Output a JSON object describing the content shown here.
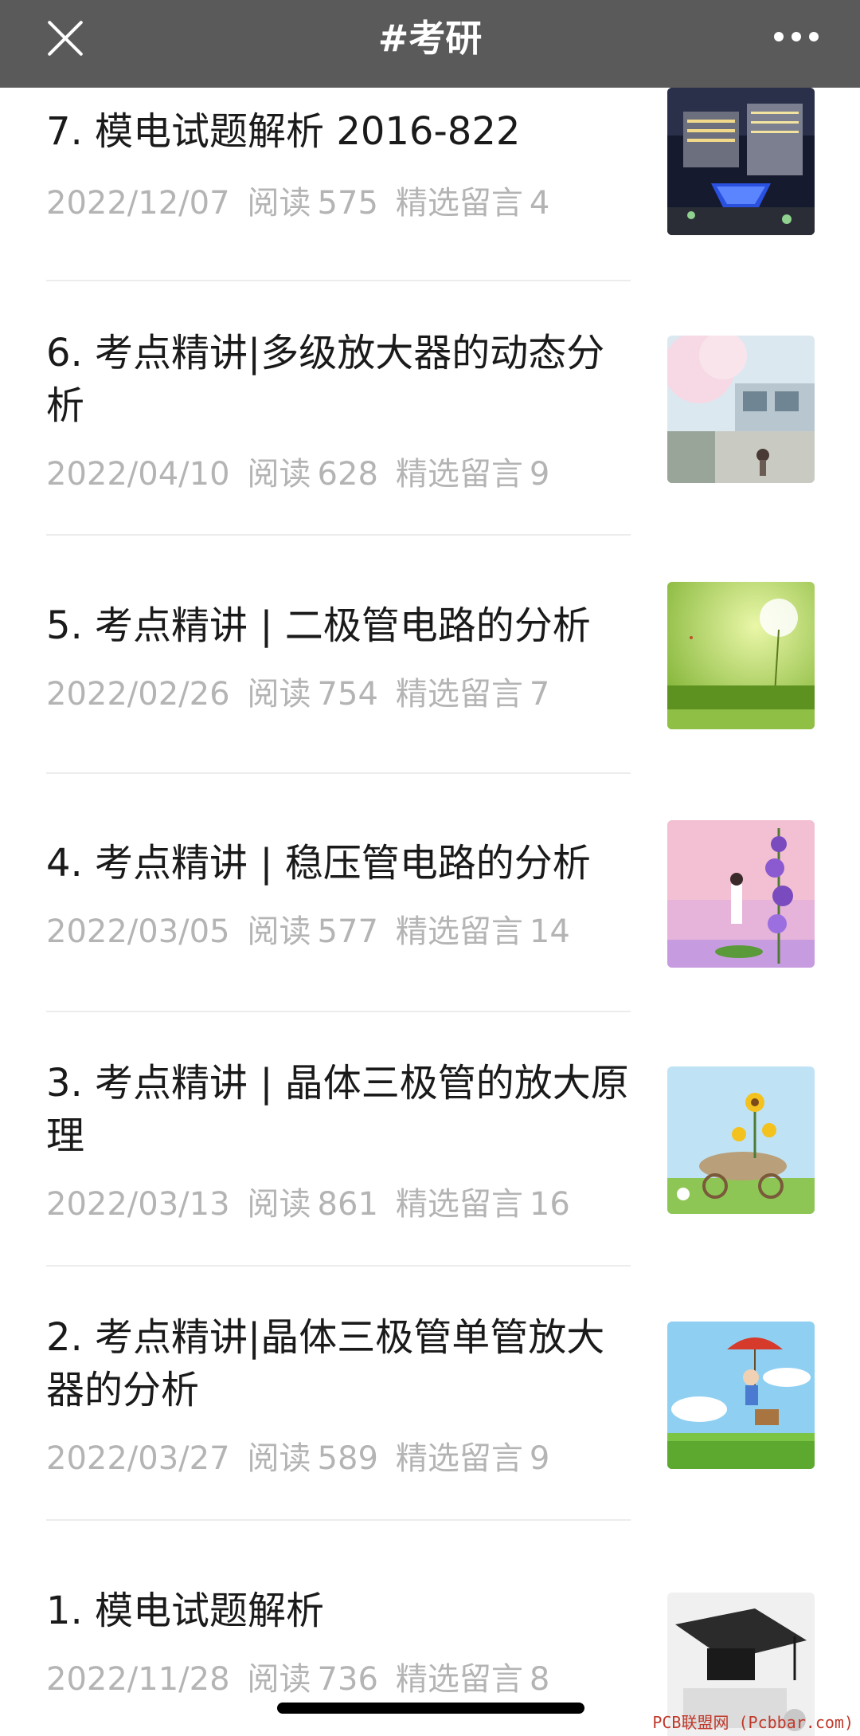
{
  "header": {
    "title": "#考研"
  },
  "icons": {
    "close": "close-icon",
    "more": "more-icon"
  },
  "meta_labels": {
    "read": "阅读",
    "comments": "精选留言"
  },
  "items": [
    {
      "title": "7. 模电试题解析 2016-822",
      "date": "2022/12/07",
      "reads": "575",
      "comments": "4",
      "thumb": "campus-night-scene"
    },
    {
      "title": "6. 考点精讲|多级放大器的动态分析",
      "date": "2022/04/10",
      "reads": "628",
      "comments": "9",
      "thumb": "cherry-blossom-street"
    },
    {
      "title": "5. 考点精讲 | 二极管电路的分析",
      "date": "2022/02/26",
      "reads": "754",
      "comments": "7",
      "thumb": "green-dandelion-field"
    },
    {
      "title": "4. 考点精讲 | 稳压管电路的分析",
      "date": "2022/03/05",
      "reads": "577",
      "comments": "14",
      "thumb": "pink-girl-lavender"
    },
    {
      "title": "3. 考点精讲 | 晶体三极管的放大原理",
      "date": "2022/03/13",
      "reads": "861",
      "comments": "16",
      "thumb": "sunflower-cart"
    },
    {
      "title": "2. 考点精讲|晶体三极管单管放大器的分析",
      "date": "2022/03/27",
      "reads": "589",
      "comments": "9",
      "thumb": "girl-with-umbrella"
    },
    {
      "title": "1. 模电试题解析",
      "date": "2022/11/28",
      "reads": "736",
      "comments": "8",
      "thumb": "graduation-cap"
    }
  ],
  "watermark": "PCB联盟网 (Pcbbar.com)"
}
